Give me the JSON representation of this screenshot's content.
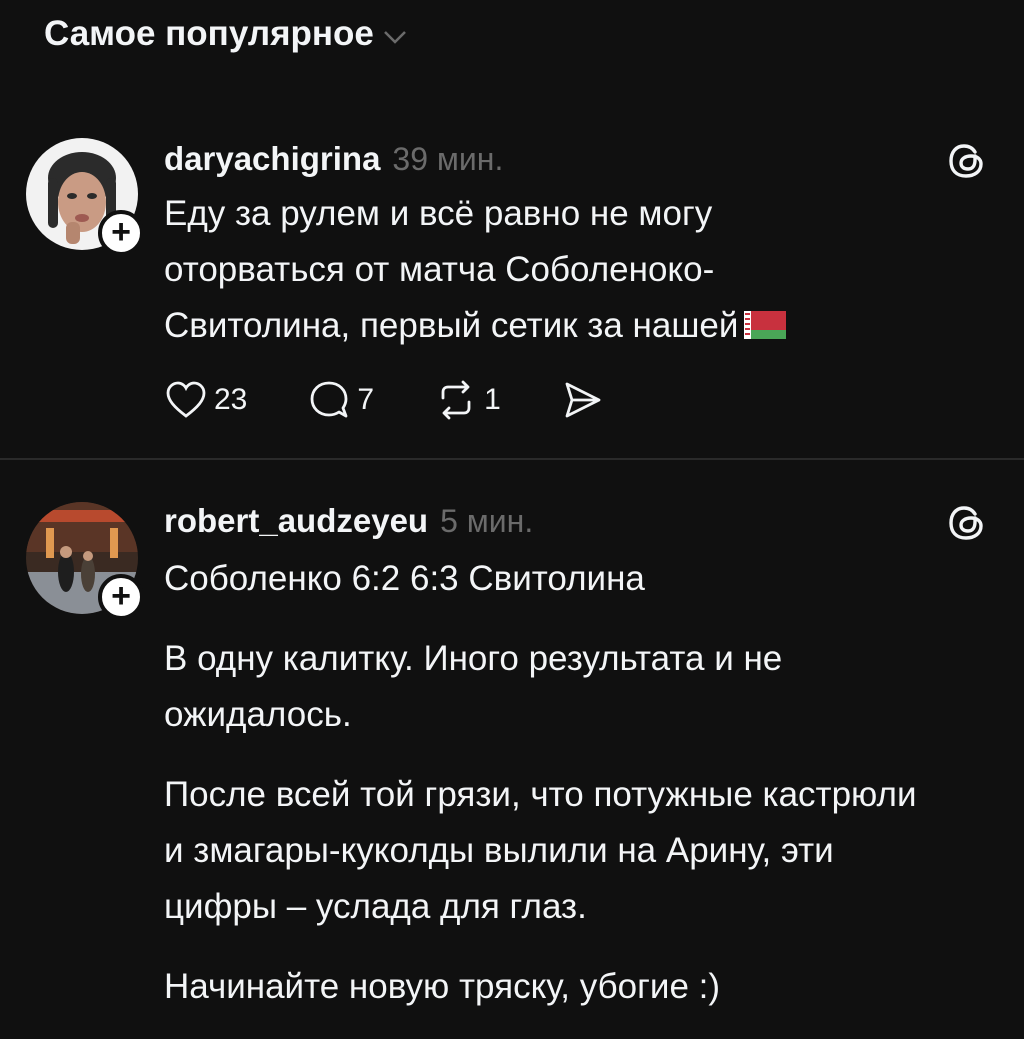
{
  "header": {
    "sort_label": "Самое популярное"
  },
  "posts": [
    {
      "username": "daryachigrina",
      "time": "39 мин.",
      "text_lines": [
        "Еду за рулем и всё равно не могу",
        "оторваться от матча Соболеноко-",
        "Свитолина, первый сетик за нашей"
      ],
      "flag_emoji": "belarus-flag",
      "likes": "23",
      "replies": "7",
      "reposts": "1"
    },
    {
      "username": "robert_audzeyeu",
      "time": "5 мин.",
      "paragraphs": [
        "Соболенко 6:2 6:3 Свитолина",
        "В одну калитку. Иного результата и не ожидалось.",
        "После всей той грязи, что потужные кастрюли и змагары-куколды вылили на Арину, эти цифры – услада для глаз.",
        "Начинайте новую тряску, убогие :)"
      ]
    }
  ],
  "colors": {
    "background": "#101010",
    "text": "#f3f5f7",
    "muted": "#6b6b6b",
    "flag_red": "#c8313e",
    "flag_green": "#4aa657"
  }
}
